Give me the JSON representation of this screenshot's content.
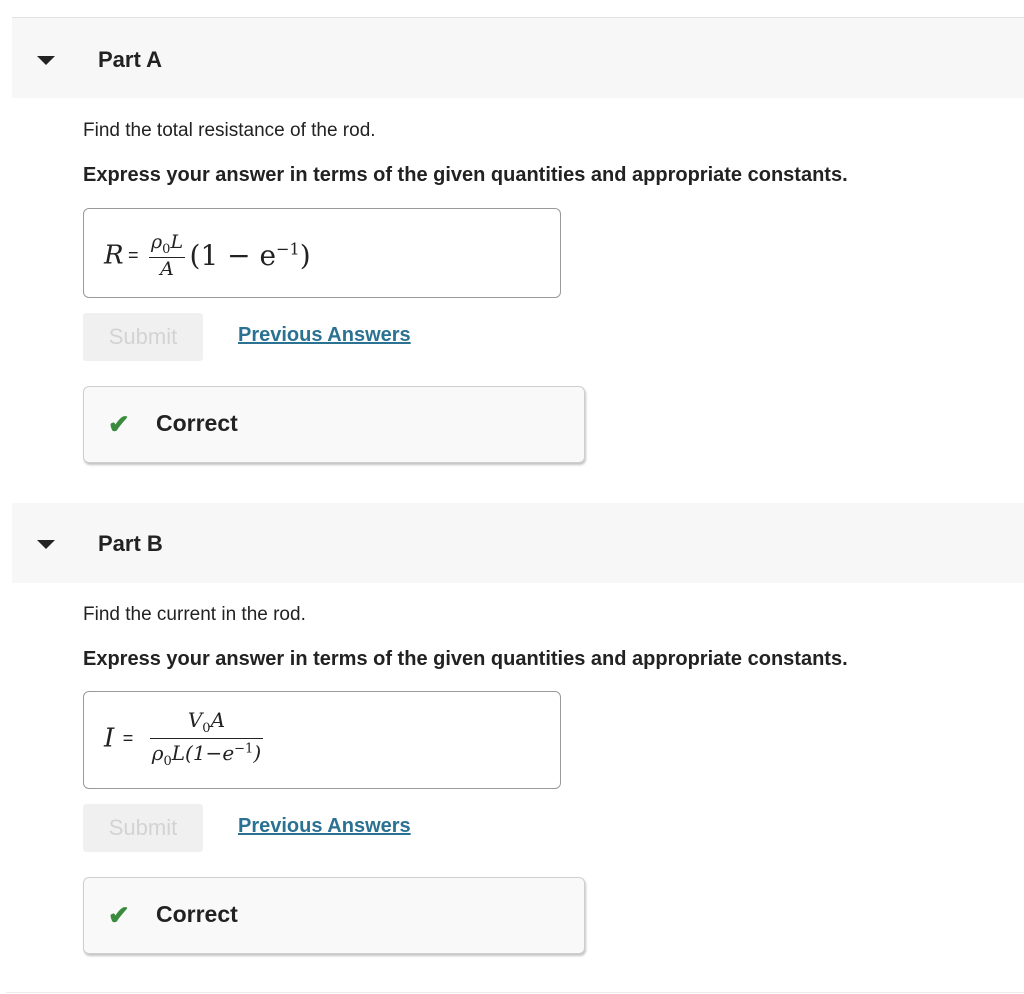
{
  "parts": [
    {
      "title": "Part A",
      "prompt": "Find the total resistance of the rod.",
      "instruction": "Express your answer in terms of the given quantities and appropriate constants.",
      "answer": {
        "lhs": "R",
        "equals": "=",
        "text": "R = (ρ0 L / A)(1 − e^−1)",
        "num_rho": "ρ",
        "num_sub": "0",
        "num_var": "L",
        "den": "A",
        "paren": "(1 − e",
        "exp": "−1",
        "close": ")"
      },
      "submit_label": "Submit",
      "previous_answers_label": "Previous Answers",
      "feedback": {
        "status": "Correct",
        "icon": "check-icon",
        "color": "#3a8a3f"
      }
    },
    {
      "title": "Part B",
      "prompt": "Find the current in the rod.",
      "instruction": "Express your answer in terms of the given quantities and appropriate constants.",
      "answer": {
        "lhs": "I",
        "equals": "=",
        "text": "I = V0 A / (ρ0 L (1−e^−1))",
        "num_v": "V",
        "num_sub": "0",
        "num_a": "A",
        "den_rho": "ρ",
        "den_sub": "0",
        "den_rest": "L(1−e",
        "den_exp": "−1",
        "den_close": ")"
      },
      "submit_label": "Submit",
      "previous_answers_label": "Previous Answers",
      "feedback": {
        "status": "Correct",
        "icon": "check-icon",
        "color": "#3a8a3f"
      }
    }
  ],
  "colors": {
    "link": "#2b7192",
    "success": "#3a8a3f",
    "header_bg": "#f7f7f7"
  }
}
